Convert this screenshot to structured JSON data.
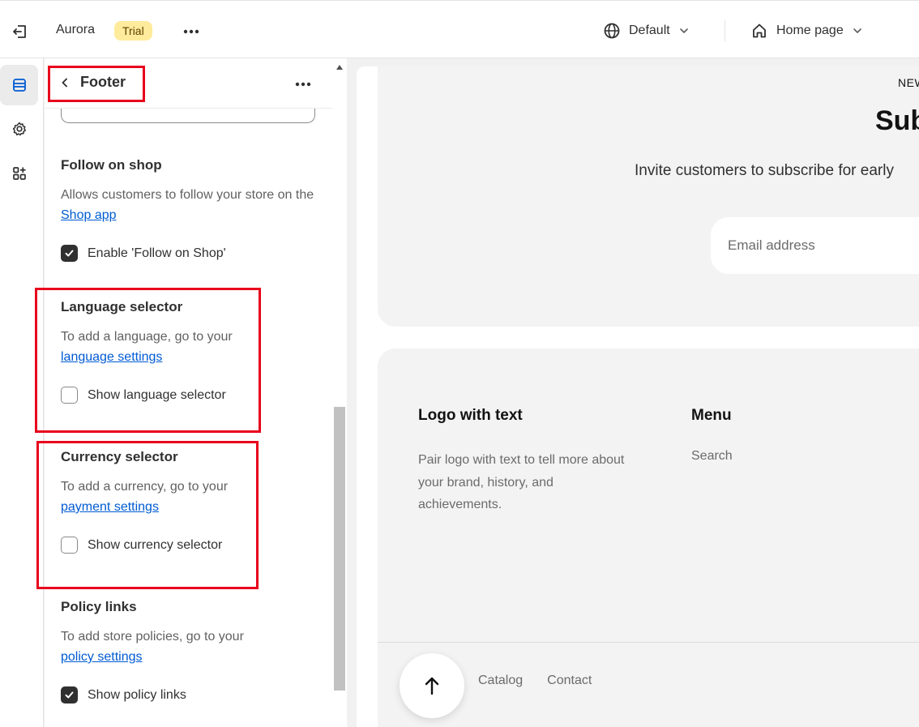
{
  "topbar": {
    "store_name": "Aurora",
    "badge": "Trial",
    "theme_label": "Default",
    "page_label": "Home page"
  },
  "panel": {
    "title": "Footer",
    "follow": {
      "heading": "Follow on shop",
      "text": "Allows customers to follow your store on the",
      "link": "Shop app",
      "checkbox_label": "Enable 'Follow on Shop'",
      "checked": true
    },
    "language": {
      "heading": "Language selector",
      "text": "To add a language, go to your",
      "link": "language settings",
      "checkbox_label": "Show language selector",
      "checked": false
    },
    "currency": {
      "heading": "Currency selector",
      "text": "To add a currency, go to your",
      "link": "payment settings",
      "checkbox_label": "Show currency selector",
      "checked": false
    },
    "policy": {
      "heading": "Policy links",
      "text": "To add store policies, go to your",
      "link": "policy settings",
      "checkbox_label": "Show policy links",
      "checked": true
    }
  },
  "preview": {
    "newsletter": {
      "kicker": "NEW",
      "title": "Sub",
      "subtitle": "Invite customers to subscribe for early",
      "email_placeholder": "Email address"
    },
    "footer": {
      "col1_heading": "Logo with text",
      "col1_text": "Pair logo with text to tell more about your brand, history, and achievements.",
      "col2_heading": "Menu",
      "col2_link": "Search",
      "bottom_links": [
        "Catalog",
        "Contact"
      ]
    }
  },
  "colors": {
    "accent_link": "#005bd3",
    "badge_bg": "#ffeb9c",
    "highlight": "#e8001c"
  }
}
